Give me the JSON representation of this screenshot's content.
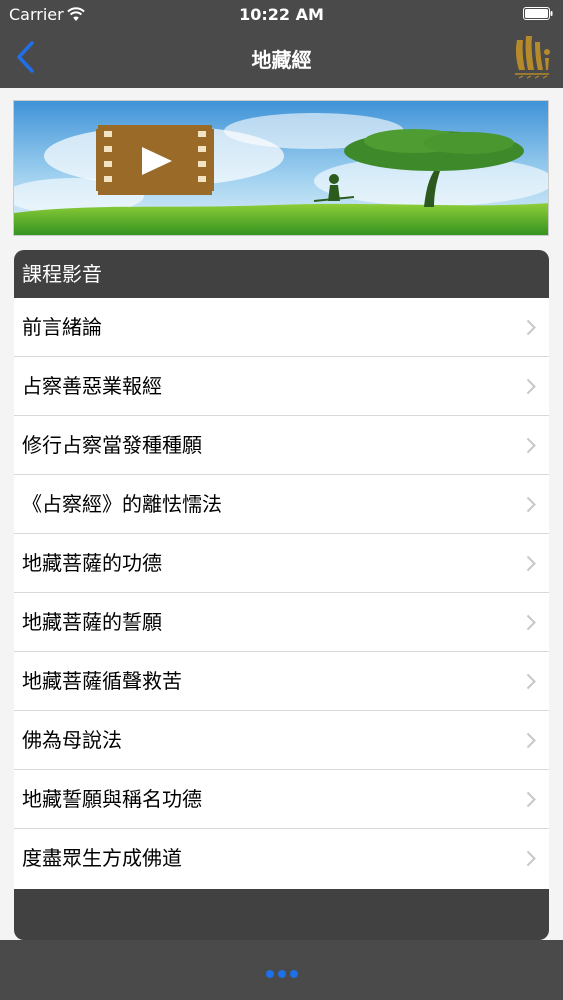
{
  "status_bar": {
    "carrier": "Carrier",
    "time": "10:22 AM"
  },
  "nav": {
    "title": "地藏經",
    "back_icon": "chevron-left-icon",
    "accent_color": "#1e6fe8"
  },
  "banner": {
    "icon": "video-play-icon"
  },
  "section": {
    "header": "課程影音",
    "items": [
      {
        "label": "前言緒論"
      },
      {
        "label": "占察善惡業報經"
      },
      {
        "label": "修行占察當發種種願"
      },
      {
        "label": "《占察經》的離怯懦法"
      },
      {
        "label": "地藏菩薩的功德"
      },
      {
        "label": "地藏菩薩的誓願"
      },
      {
        "label": "地藏菩薩循聲救苦"
      },
      {
        "label": "佛為母說法"
      },
      {
        "label": "地藏誓願與稱名功德"
      },
      {
        "label": "度盡眾生方成佛道"
      }
    ]
  },
  "bottom_bar": {
    "icon": "more-dots-icon"
  }
}
